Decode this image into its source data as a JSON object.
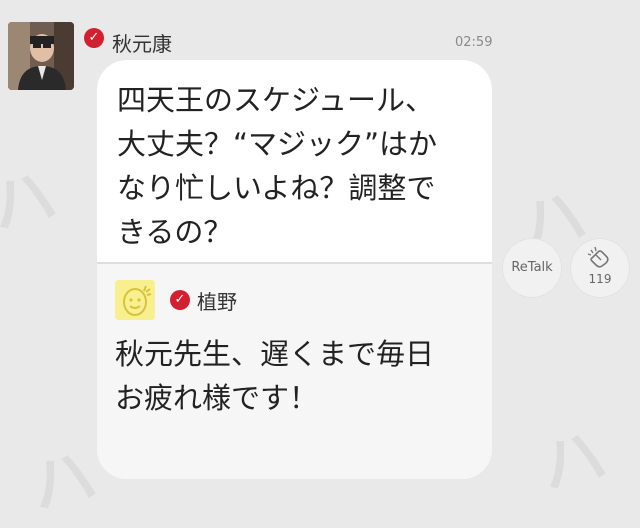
{
  "post": {
    "sender_name": "秋元康",
    "time": "02:59",
    "message": "四天王のスケジュール、\n大丈夫？“マジック”はか\nなり忙しいよね？調整で\nきるの？"
  },
  "quoted": {
    "sender_name": "植野",
    "message": "秋元先生、遅くまで毎日\nお疲れ様です！"
  },
  "actions": {
    "retalk_label": "ReTalk",
    "clap_count": "119"
  },
  "colors": {
    "verified": "#d32030",
    "background": "#e9e9e9"
  }
}
